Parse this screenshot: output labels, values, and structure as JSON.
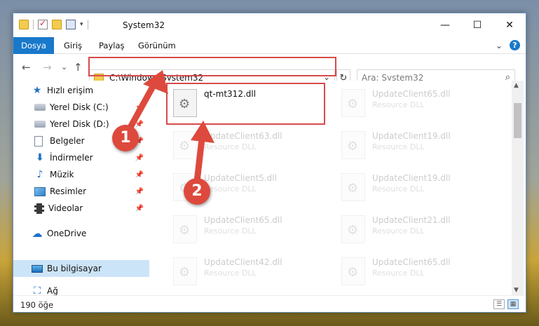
{
  "window": {
    "title": "System32",
    "controls": {
      "minimize": "—",
      "maximize": "☐",
      "close": "✕"
    }
  },
  "ribbon": {
    "tabs": [
      {
        "label": "Dosya",
        "active": true
      },
      {
        "label": "Giriş",
        "active": false
      },
      {
        "label": "Paylaş",
        "active": false
      },
      {
        "label": "Görünüm",
        "active": false
      }
    ],
    "expand": "⌄",
    "help": "?"
  },
  "nav": {
    "back": "←",
    "forward": "→",
    "recent": "⌄",
    "up": "↑"
  },
  "address": {
    "path": "C:\\Windows\\System32",
    "dropdown": "⌄",
    "refresh": "↻"
  },
  "search": {
    "placeholder": "Ara: System32",
    "icon": "⌕"
  },
  "sidebar": {
    "items": [
      {
        "label": "Hızlı erişim",
        "icon": "star-icon",
        "pinned": false
      },
      {
        "label": "Yerel Disk (C:)",
        "icon": "disk-icon",
        "pinned": true
      },
      {
        "label": "Yerel Disk (D:)",
        "icon": "disk-icon",
        "pinned": true
      },
      {
        "label": "Belgeler",
        "icon": "document-icon",
        "pinned": true
      },
      {
        "label": "İndirmeler",
        "icon": "download-icon",
        "pinned": true
      },
      {
        "label": "Müzik",
        "icon": "music-icon",
        "pinned": true
      },
      {
        "label": "Resimler",
        "icon": "pictures-icon",
        "pinned": true
      },
      {
        "label": "Videolar",
        "icon": "videos-icon",
        "pinned": true
      },
      {
        "label": "OneDrive",
        "icon": "cloud-icon",
        "pinned": false
      },
      {
        "label": "Bu bilgisayar",
        "icon": "computer-icon",
        "pinned": false,
        "selected": true
      },
      {
        "label": "Ağ",
        "icon": "network-icon",
        "pinned": false
      }
    ],
    "pin_glyph": "📌"
  },
  "files": [
    {
      "name": "qt-mt312.dll",
      "type": "",
      "faded": false
    },
    {
      "name": "UpdateClient65.dll",
      "type": "Resource DLL",
      "faded": true
    },
    {
      "name": "UpdateClient63.dll",
      "type": "Resource DLL",
      "faded": true
    },
    {
      "name": "UpdateClient19.dll",
      "type": "Resource DLL",
      "faded": true
    },
    {
      "name": "UpdateClient5.dll",
      "type": "Resource DLL",
      "faded": true
    },
    {
      "name": "UpdateClient19.dll",
      "type": "Resource DLL",
      "faded": true
    },
    {
      "name": "UpdateClient65.dll",
      "type": "Resource DLL",
      "faded": true
    },
    {
      "name": "UpdateClient21.dll",
      "type": "Resource DLL",
      "faded": true
    },
    {
      "name": "UpdateClient42.dll",
      "type": "Resource DLL",
      "faded": true
    },
    {
      "name": "UpdateClient65.dll",
      "type": "Resource DLL",
      "faded": true
    }
  ],
  "status": {
    "count": "190 öğe"
  },
  "annotations": {
    "step1": "1",
    "step2": "2",
    "color": "#dd4a3d"
  }
}
